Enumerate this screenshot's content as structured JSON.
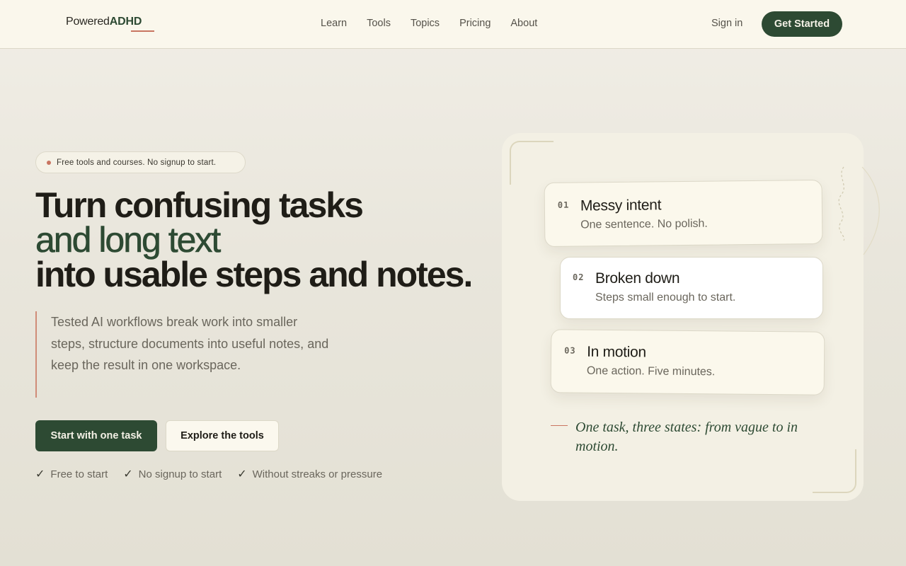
{
  "header": {
    "logo_prefix": "Powered",
    "logo_strong": "ADHD",
    "nav": [
      "Learn",
      "Tools",
      "Topics",
      "Pricing",
      "About"
    ],
    "signin": "Sign in",
    "cta": "Get Started"
  },
  "hero": {
    "badge": "Free tools and courses. No signup to start.",
    "headline_1": "Turn confusing tasks",
    "headline_2": "and long text",
    "headline_3": "into usable steps and notes.",
    "description": "Tested AI workflows break work into smaller steps, structure documents into useful notes, and keep the result in one workspace.",
    "primary_button": "Start with one task",
    "secondary_button": "Explore the tools",
    "checks": [
      "Free to start",
      "No signup to start",
      "Without streaks or pressure"
    ]
  },
  "steps": [
    {
      "num": "01",
      "title": "Messy intent",
      "sub": "One sentence. No polish."
    },
    {
      "num": "02",
      "title": "Broken down",
      "sub": "Steps small enough to start."
    },
    {
      "num": "03",
      "title": "In motion",
      "sub": "One action. Five minutes."
    }
  ],
  "caption": "One task, three states: from vague to in motion.",
  "colors": {
    "brand_green": "#2d4a33",
    "accent_coral": "#c97561",
    "header_bg": "#faf7ec",
    "card_bg": "#f3f0e4"
  }
}
